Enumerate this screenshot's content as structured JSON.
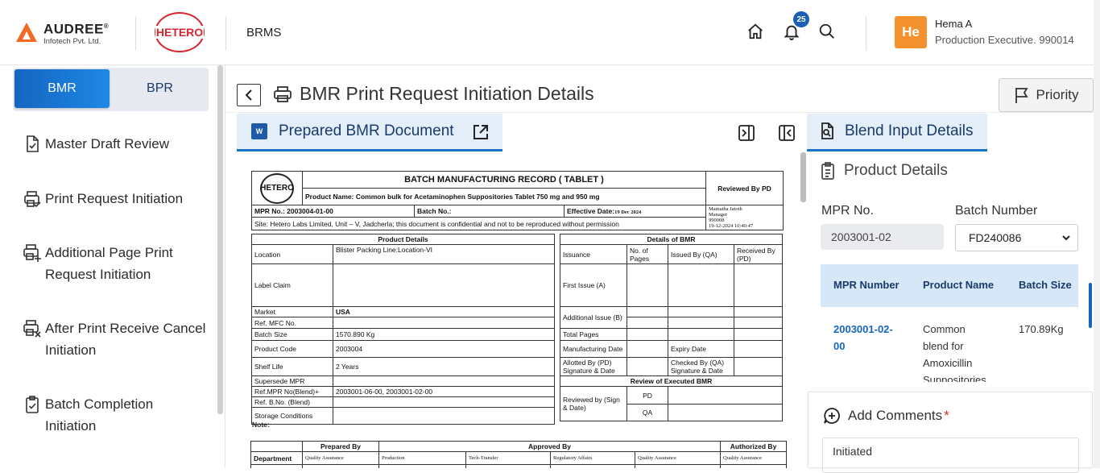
{
  "header": {
    "company_name": "AUDREE",
    "company_reg": "®",
    "company_sub": "Infotech Pvt. Ltd.",
    "client_logo": "HETERO",
    "app_name": "BRMS",
    "notification_count": "25",
    "user_initials": "He",
    "user_name": "Hema A",
    "user_role": "Production Executive. 990014"
  },
  "sidebar": {
    "segments": {
      "active": "BMR",
      "inactive": "BPR"
    },
    "items": [
      {
        "label": "Master Draft Review",
        "icon": "doc-check-icon"
      },
      {
        "label": "Print Request Initiation",
        "icon": "printer-check-icon"
      },
      {
        "label_l1": "Additional Page Print",
        "label_l2": "Request Initiation",
        "icon": "printer-plus-icon"
      },
      {
        "label_l1": "After Print Receive Cancel",
        "label_l2": "Initiation",
        "icon": "printer-x-icon"
      },
      {
        "label_l1": "Batch Completion",
        "label_l2": "Initiation",
        "icon": "clipboard-check-icon"
      }
    ]
  },
  "page": {
    "title": "BMR Print Request Initiation Details",
    "priority_label": "Priority"
  },
  "document": {
    "tab_label": "Prepared BMR Document",
    "record": {
      "logo": "HETERO",
      "title": "BATCH MANUFACTURING RECORD ( TABLET )",
      "product_name": "Product Name: Common bulk for Acetaminophen Suppositories Tablet 750 mg and 950 mg",
      "reviewed_by_pd": "Reviewed By PD",
      "mpr_no": "MPR No.: 2003004-01-00",
      "batch_no": "Batch No.:",
      "effective_label": "Effective Date:",
      "effective_date": "19 Dec 2024",
      "reviewer_name": "Mamatha  Jatoth",
      "reviewer_role": "Manager",
      "reviewer_id": "990008",
      "reviewer_ts": "19-12-2024 10:40:47",
      "site": "Site: Hetero Labs Limited, Unit – V, Jadcherla; this document is confidential and not to be reproduced without permission",
      "product_details_head": "Product Details",
      "details_bmr_head": "Details of BMR",
      "location_label": "Location",
      "location_value": "Blister Packing Line:Location-VI",
      "label_claim": "Label Claim",
      "market_label": "Market",
      "market_value": "USA",
      "ref_mfc": "Ref. MFC No.",
      "batch_size_label": "Batch Size",
      "batch_size_value": "1570.890 Kg",
      "product_code_label": "Product Code",
      "product_code_value": "2003004",
      "shelf_life_label": "Shelf Life",
      "shelf_life_value": "2 Years",
      "supersede_mpr": "Supersede MPR",
      "ref_mpr_blend": "Ref.MPR No(Blend)+",
      "ref_mpr_value": "2003001-06-00, 2003001-02-00",
      "ref_bno_blend": "Ref. B.No. (Blend)",
      "storage": "Storage Conditions",
      "issuance": "Issuance",
      "no_of_pages": "No. of Pages",
      "issued_by_qa": "Issued By (QA)",
      "received_by_pd": "Received By (PD)",
      "first_issue": "First Issue (A)",
      "additional_issue": "Additional Issue (B)",
      "total_pages": "Total Pages",
      "mfg_date": "Manufacturing Date",
      "expiry_date": "Expiry Date",
      "allotted_by": "Allotted By (PD) Signature & Date",
      "checked_by": "Checked By (QA) Signature & Date",
      "review_exec": "Review of Executed BMR",
      "reviewed_by": "Reviewed by (Sign & Date)",
      "pd": "PD",
      "qa": "QA",
      "note": "Note:",
      "prepared_by": "Prepared By",
      "approved_by": "Approved By",
      "authorized_by": "Authorized By",
      "department": "Department",
      "depts": [
        "Quality Assurance",
        "Production",
        "Tech-Transfer",
        "Regulatory Affairs",
        "Quality Assurance",
        "Quality Assurance"
      ]
    }
  },
  "blend": {
    "tab_label": "Blend Input Details",
    "product_details": "Product Details",
    "mpr_label": "MPR No.",
    "mpr_value": "2003001-02",
    "batch_label": "Batch Number",
    "batch_value": "FD240086",
    "grid": {
      "headers": [
        "MPR Number",
        "Product Name",
        "Batch Size"
      ],
      "row": {
        "mpr_l1": "2003001-02-",
        "mpr_l2": "00",
        "name_l1": "Common",
        "name_l2": "blend for",
        "name_l3": "Amoxicillin",
        "name_l4": "Suppositories",
        "size": "170.89Kg"
      }
    }
  },
  "comments": {
    "title": "Add Comments",
    "required": "*",
    "value": "Initiated"
  }
}
